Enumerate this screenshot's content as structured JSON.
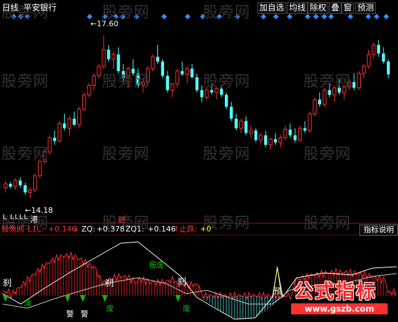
{
  "header": {
    "period_label": "日线",
    "stock_name": "平安银行",
    "toolbar": [
      "加自选",
      "均线",
      "除权",
      "叠",
      "窗",
      "预测"
    ]
  },
  "watermark": "股旁网",
  "main_chart": {
    "high_label": "17.60",
    "low_label": "14.18",
    "price_range": [
      13.9,
      17.85
    ],
    "marker_fin": "财",
    "marker_gang": "港",
    "bottom_marks": "L LLLL",
    "candles": [
      [
        14.4,
        14.55,
        14.3,
        14.48
      ],
      [
        14.48,
        14.52,
        14.38,
        14.42
      ],
      [
        14.42,
        14.6,
        14.35,
        14.55
      ],
      [
        14.55,
        14.62,
        14.4,
        14.45
      ],
      [
        14.45,
        14.5,
        14.25,
        14.3
      ],
      [
        14.3,
        14.4,
        14.18,
        14.35
      ],
      [
        14.35,
        14.7,
        14.3,
        14.65
      ],
      [
        14.65,
        15.0,
        14.6,
        14.95
      ],
      [
        14.95,
        15.2,
        14.9,
        15.15
      ],
      [
        15.15,
        15.5,
        15.1,
        15.45
      ],
      [
        15.45,
        15.6,
        15.3,
        15.38
      ],
      [
        15.38,
        15.8,
        15.35,
        15.75
      ],
      [
        15.75,
        15.95,
        15.6,
        15.65
      ],
      [
        15.65,
        15.9,
        15.5,
        15.85
      ],
      [
        15.85,
        16.0,
        15.7,
        15.72
      ],
      [
        15.72,
        16.1,
        15.65,
        16.05
      ],
      [
        16.05,
        16.4,
        16.0,
        16.35
      ],
      [
        16.35,
        16.6,
        16.3,
        16.55
      ],
      [
        16.55,
        16.8,
        16.45,
        16.75
      ],
      [
        16.75,
        17.0,
        16.7,
        16.95
      ],
      [
        16.95,
        17.6,
        16.9,
        17.3
      ],
      [
        17.3,
        17.4,
        17.05,
        17.1
      ],
      [
        17.1,
        17.25,
        16.9,
        17.2
      ],
      [
        17.2,
        17.35,
        16.8,
        16.85
      ],
      [
        16.85,
        17.0,
        16.6,
        16.7
      ],
      [
        16.7,
        16.95,
        16.5,
        16.9
      ],
      [
        16.9,
        17.1,
        16.75,
        16.8
      ],
      [
        16.8,
        16.9,
        16.5,
        16.55
      ],
      [
        16.55,
        16.7,
        16.4,
        16.62
      ],
      [
        16.62,
        16.95,
        16.55,
        16.9
      ],
      [
        16.9,
        17.2,
        16.85,
        17.15
      ],
      [
        17.15,
        17.4,
        17.0,
        17.05
      ],
      [
        17.05,
        17.1,
        16.7,
        16.75
      ],
      [
        16.75,
        16.85,
        16.4,
        16.45
      ],
      [
        16.45,
        16.6,
        16.3,
        16.58
      ],
      [
        16.58,
        16.9,
        16.5,
        16.85
      ],
      [
        16.85,
        17.05,
        16.75,
        16.78
      ],
      [
        16.78,
        16.95,
        16.6,
        16.9
      ],
      [
        16.9,
        17.0,
        16.7,
        16.72
      ],
      [
        16.72,
        16.8,
        16.4,
        16.45
      ],
      [
        16.45,
        16.55,
        16.2,
        16.3
      ],
      [
        16.3,
        16.5,
        16.25,
        16.45
      ],
      [
        16.45,
        16.6,
        16.35,
        16.4
      ],
      [
        16.4,
        16.5,
        16.25,
        16.48
      ],
      [
        16.48,
        16.55,
        16.3,
        16.35
      ],
      [
        16.35,
        16.4,
        16.05,
        16.1
      ],
      [
        16.1,
        16.2,
        15.8,
        15.85
      ],
      [
        15.85,
        15.95,
        15.6,
        15.65
      ],
      [
        15.65,
        15.85,
        15.55,
        15.8
      ],
      [
        15.8,
        15.9,
        15.5,
        15.55
      ],
      [
        15.55,
        15.7,
        15.45,
        15.6
      ],
      [
        15.6,
        15.65,
        15.35,
        15.4
      ],
      [
        15.4,
        15.55,
        15.3,
        15.5
      ],
      [
        15.5,
        15.6,
        15.25,
        15.3
      ],
      [
        15.3,
        15.45,
        15.2,
        15.42
      ],
      [
        15.42,
        15.55,
        15.3,
        15.35
      ],
      [
        15.35,
        15.5,
        15.25,
        15.45
      ],
      [
        15.45,
        15.7,
        15.4,
        15.62
      ],
      [
        15.62,
        15.75,
        15.45,
        15.5
      ],
      [
        15.5,
        15.65,
        15.35,
        15.4
      ],
      [
        15.4,
        15.7,
        15.35,
        15.65
      ],
      [
        15.65,
        15.8,
        15.55,
        15.6
      ],
      [
        15.6,
        16.0,
        15.55,
        15.95
      ],
      [
        15.95,
        16.3,
        15.9,
        16.25
      ],
      [
        16.25,
        16.4,
        16.1,
        16.15
      ],
      [
        16.15,
        16.5,
        16.1,
        16.45
      ],
      [
        16.45,
        16.6,
        16.3,
        16.35
      ],
      [
        16.35,
        16.55,
        16.2,
        16.5
      ],
      [
        16.5,
        16.7,
        16.35,
        16.4
      ],
      [
        16.4,
        16.55,
        16.25,
        16.52
      ],
      [
        16.52,
        16.7,
        16.45,
        16.62
      ],
      [
        16.62,
        16.8,
        16.45,
        16.5
      ],
      [
        16.5,
        16.85,
        16.45,
        16.8
      ],
      [
        16.8,
        17.0,
        16.7,
        16.95
      ],
      [
        16.95,
        17.3,
        16.9,
        17.2
      ],
      [
        17.2,
        17.45,
        17.1,
        17.4
      ],
      [
        17.4,
        17.5,
        17.15,
        17.22
      ],
      [
        17.22,
        17.35,
        17.0,
        17.05
      ],
      [
        17.05,
        17.1,
        16.7,
        16.78
      ]
    ]
  },
  "indicator": {
    "name": "股旁网",
    "params": "L1L:",
    "v1": "+0.146",
    "zq_label": "ZQ:",
    "zq_value": "+0.378",
    "zq1_label": "ZQ1:",
    "zq1_value": "+0.146",
    "stop_label": "止跌:",
    "stop_value": "+0",
    "button": "指标说明",
    "signal_sha": "刹",
    "signal_fei": "废",
    "signal_jing": "警",
    "signal_baofei": "报废",
    "signal_yu": "预"
  },
  "badge": {
    "title": "公式指标",
    "url": "www.gszb.com"
  },
  "colors": {
    "up": "#ff3232",
    "down": "#54ffff",
    "diamond": "#2f8fff",
    "signal_green": "#00c000"
  }
}
